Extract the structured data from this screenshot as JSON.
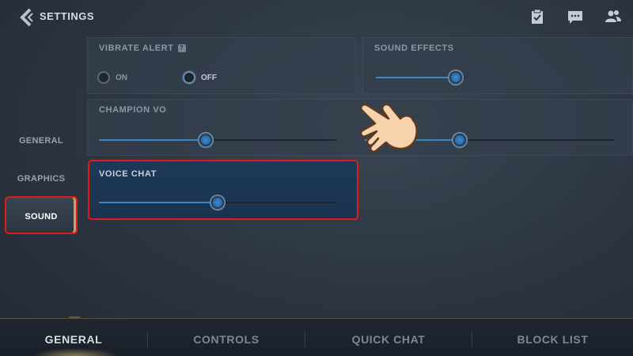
{
  "header": {
    "title": "SETTINGS",
    "icons": [
      "back-chevron-icon",
      "missions-clipboard-icon",
      "chat-icon",
      "friends-icon"
    ]
  },
  "sidebar": {
    "items": [
      {
        "label": "GENERAL",
        "active": false
      },
      {
        "label": "GRAPHICS",
        "active": false
      },
      {
        "label": "SOUND",
        "active": true
      }
    ]
  },
  "sound": {
    "vibrate_alert": {
      "label": "VIBRATE ALERT",
      "help": "?",
      "on_label": "ON",
      "off_label": "OFF",
      "selected": "OFF"
    },
    "sound_effects": {
      "label": "SOUND EFFECTS",
      "value": 0.9
    },
    "champion_vo": {
      "label": "CHAMPION VO",
      "value": 0.45
    },
    "music": {
      "value": 0.38
    },
    "voice_chat": {
      "label": "VOICE CHAT",
      "value": 0.5
    }
  },
  "bottom_tabs": [
    {
      "label": "GENERAL",
      "active": true
    },
    {
      "label": "CONTROLS",
      "active": false
    },
    {
      "label": "QUICK CHAT",
      "active": false
    },
    {
      "label": "BLOCK LIST",
      "active": false
    }
  ],
  "colors": {
    "highlight_border": "#e21a1a",
    "slider_fill": "#3a85c5",
    "active_tab_glow": "#e6c878"
  }
}
